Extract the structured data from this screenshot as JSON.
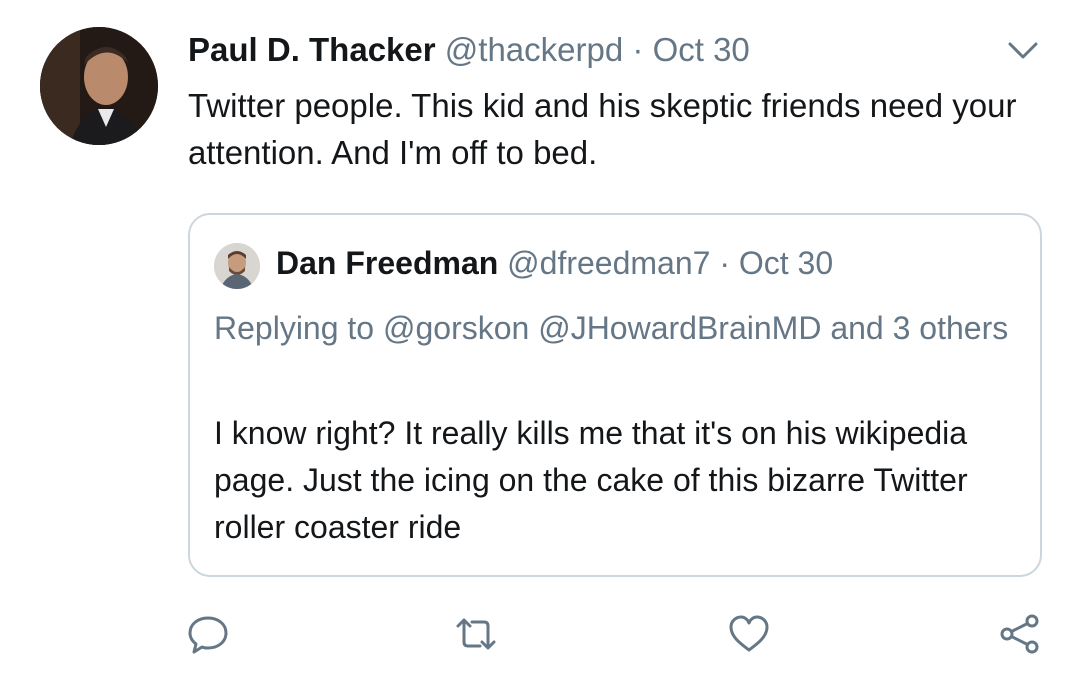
{
  "tweet": {
    "author_name": "Paul D. Thacker",
    "author_handle": "@thackerpd",
    "separator": "·",
    "date": "Oct 30",
    "text": "Twitter people. This kid and his skeptic friends need your attention. And I'm off to bed.",
    "avatar_icon": "profile-photo"
  },
  "quoted": {
    "author_name": "Dan Freedman",
    "author_handle": "@dfreedman7",
    "separator": "·",
    "date": "Oct 30",
    "replying_to": "Replying to @gorskon @JHowardBrainMD and 3 others",
    "text": "I know right? It really kills me that it's on his wikipedia page. Just the icing on the cake of this bizarre Twitter roller coaster ride",
    "avatar_icon": "profile-photo"
  },
  "actions": [
    {
      "icon": "reply-icon"
    },
    {
      "icon": "retweet-icon"
    },
    {
      "icon": "like-icon"
    },
    {
      "icon": "share-icon"
    }
  ],
  "colors": {
    "text": "#14171a",
    "secondary": "#657786",
    "border": "#ccd6dd",
    "icon": "#657786"
  }
}
